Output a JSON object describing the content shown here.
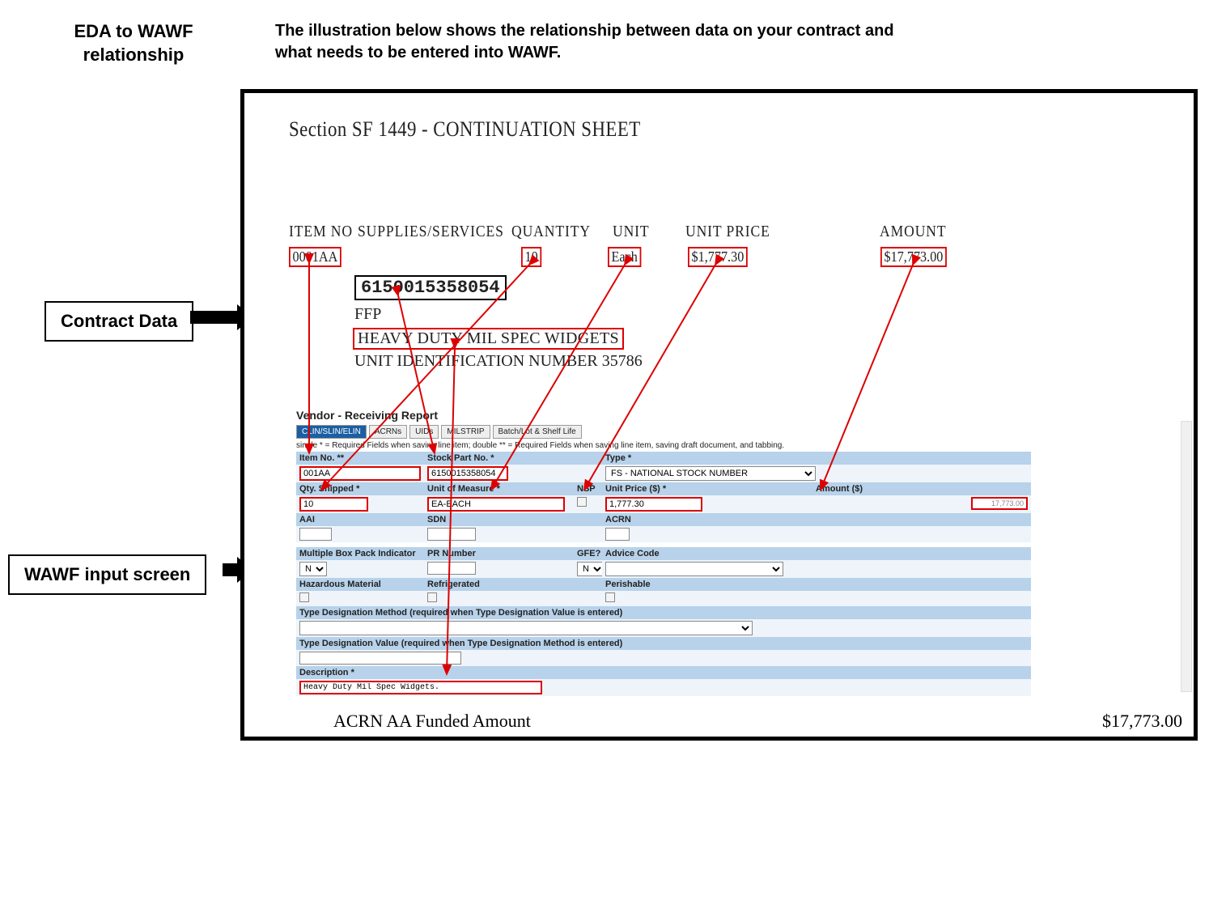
{
  "header": {
    "title": "EDA to WAWF relationship",
    "description": "The illustration below shows the relationship between data on your contract and what needs to be entered into WAWF."
  },
  "label_boxes": {
    "contract_data": "Contract Data",
    "wawf_input": "WAWF input screen"
  },
  "contract": {
    "section_title": "Section SF 1449 - CONTINUATION SHEET",
    "columns": {
      "item_no": "ITEM NO",
      "supplies": "SUPPLIES/SERVICES",
      "quantity": "QUANTITY",
      "unit": "UNIT",
      "unit_price": "UNIT PRICE",
      "amount": "AMOUNT"
    },
    "values": {
      "item_no": "0001AA",
      "quantity": "10",
      "unit": "Each",
      "unit_price": "$1,777.30",
      "amount": "$17,773.00",
      "stock_no": "6150015358054",
      "ffp": "FFP",
      "description": "HEAVY DUTY MIL SPEC WIDGETS",
      "uid_line": "UNIT IDENTIFICATION NUMBER 35786"
    }
  },
  "wawf": {
    "report_title": "Vendor - Receiving Report",
    "tabs": [
      "CLIN/SLIN/ELIN",
      "ACRNs",
      "UIDs",
      "MILSTRIP",
      "Batch/Lot & Shelf Life"
    ],
    "required_note": "single * = Required Fields when saving line item; double ** = Required Fields when saving line item, saving draft document, and tabbing.",
    "labels": {
      "item_no": "Item No. **",
      "stock_part": "Stock Part No. *",
      "type": "Type *",
      "qty_shipped": "Qty. Shipped *",
      "uom": "Unit of Measure *",
      "nsp": "NSP",
      "unit_price": "Unit Price ($) *",
      "amount": "Amount ($)",
      "aai": "AAI",
      "sdn": "SDN",
      "acrn": "ACRN",
      "mbpi": "Multiple Box Pack Indicator",
      "pr": "PR Number",
      "gfe": "GFE?",
      "advice": "Advice Code",
      "haz": "Hazardous Material",
      "refrig": "Refrigerated",
      "perish": "Perishable",
      "tdm": "Type Designation Method (required when Type Designation Value is entered)",
      "tdv": "Type Designation Value (required when Type Designation Method is entered)",
      "description": "Description *"
    },
    "values": {
      "item_no": "001AA",
      "stock_part": "6150015358054",
      "type_selected": "FS - NATIONAL STOCK NUMBER",
      "qty_shipped": "10",
      "uom": "EA-EACH",
      "unit_price": "1,777.30",
      "amount": "17,773.00",
      "mbpi_sel": "N",
      "gfe_sel": "N",
      "description": "Heavy Duty Mil Spec Widgets."
    }
  },
  "footer": {
    "acrn_label": "ACRN AA Funded Amount",
    "acrn_amount": "$17,773.00"
  }
}
